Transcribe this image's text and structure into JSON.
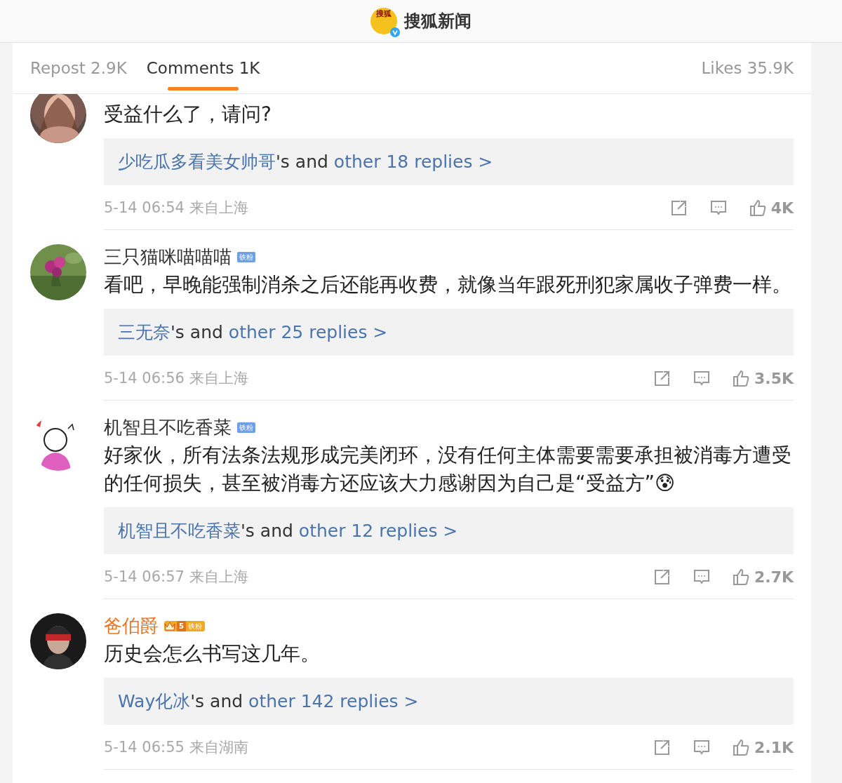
{
  "header": {
    "logo_text": "搜狐",
    "verified": true,
    "title": "搜狐新闻"
  },
  "tabs": [
    {
      "label": "Repost 2.9K",
      "selected": false
    },
    {
      "label": "Comments 1K",
      "selected": true
    },
    {
      "label": "Likes 35.9K",
      "selected": false
    }
  ],
  "comments": [
    {
      "text": "受益什么了，请问?",
      "reply": {
        "user": "少吃瓜多看美女帅哥",
        "joiner": "'s and",
        "more": "other 18 replies >"
      },
      "meta": "5-14 06:54 来自上海",
      "likes": "4K"
    },
    {
      "name": "三只猫咪喵喵喵",
      "highlighted": false,
      "badge": {
        "label": "铁粉",
        "kind": "plain"
      },
      "text": "看吧，早晚能强制消杀之后还能再收费，就像当年跟死刑犯家属收子弹费一样。",
      "reply": {
        "user": "三无奈",
        "joiner": "'s and",
        "more": "other 25 replies >"
      },
      "meta": "5-14 06:56 来自上海",
      "likes": "3.5K"
    },
    {
      "name": "机智且不吃香菜",
      "highlighted": false,
      "badge": {
        "label": "铁粉",
        "kind": "plain"
      },
      "text": "好家伙，所有法条法规形成完美闭环，没有任何主体需要需要承担被消毒方遭受的任何损失，甚至被消毒方还应该大力感谢因为自己是“受益方”😰",
      "reply": {
        "user": "机智且不吃香菜",
        "joiner": "'s and",
        "more": "other 12 replies >"
      },
      "meta": "5-14 06:57 来自上海",
      "likes": "2.7K"
    },
    {
      "name": "爸伯爵",
      "highlighted": true,
      "badge": {
        "label": "铁粉",
        "kind": "crown",
        "level": "5"
      },
      "text": "历史会怎么书写这几年。",
      "reply": {
        "user": "Way化冰",
        "joiner": "'s and",
        "more": "other 142 replies >"
      },
      "meta": "5-14 06:55 来自湖南",
      "likes": "2.1K"
    }
  ]
}
